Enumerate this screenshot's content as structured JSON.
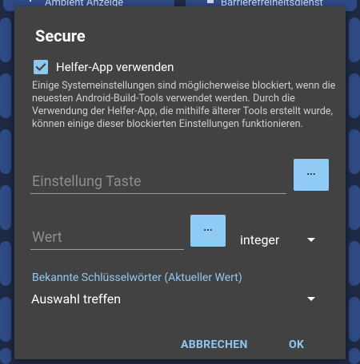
{
  "background": {
    "top_left_label": "Ambient Anzeige",
    "top_right_label": "Barrierefreiheitsdienst"
  },
  "dialog": {
    "title": "Secure",
    "helper_checkbox": {
      "label": "Helfer-App verwenden",
      "checked": true
    },
    "description": "Einige Systemeinstellungen sind möglicherweise blockiert, wenn die neuesten Android-Build-Tools verwendet werden. Durch die Verwendung der Helfer-App, die mithilfe älterer Tools erstellt wurde, können einige dieser blockierten Einstellungen funktionieren.",
    "key_field": {
      "placeholder": "Einstellung Taste",
      "picker_label": "..."
    },
    "value_field": {
      "placeholder": "Wert",
      "picker_label": "..."
    },
    "type_select": {
      "value": "integer"
    },
    "known_keywords_link": "Bekannte Schlüsselwörter (Aktueller Wert)",
    "selection_select": {
      "value": "Auswahl treffen"
    },
    "actions": {
      "cancel": "ABBRECHEN",
      "ok": "OK"
    }
  },
  "colors": {
    "dialog_bg": "#424242",
    "accent": "#90c8f2",
    "button_bg": "#8fcbf4",
    "background_tiles": "#2f4a85"
  }
}
